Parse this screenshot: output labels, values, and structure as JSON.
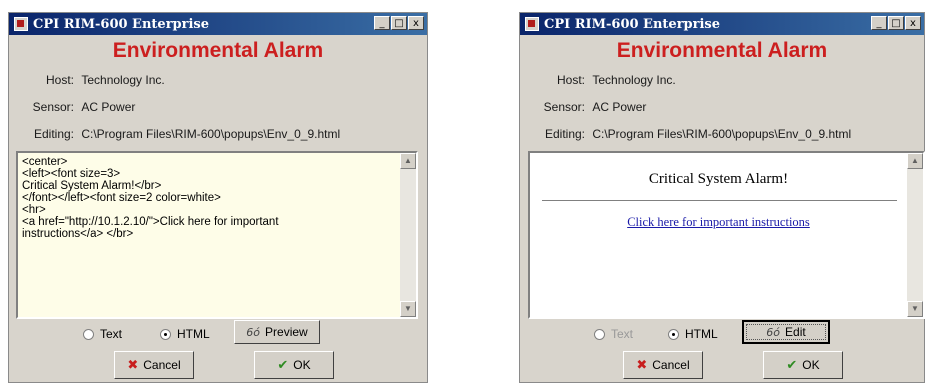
{
  "left": {
    "title": "CPI RIM-600 Enterprise",
    "heading": "Environmental Alarm",
    "host_label": "Host:",
    "host_value": "Technology Inc.",
    "sensor_label": "Sensor:",
    "sensor_value": "AC Power",
    "editing_label": "Editing:",
    "editing_value": "C:\\Program Files\\RIM-600\\popups\\Env_0_9.html",
    "editor_text": "<center>\n<left><font size=3>\nCritical System Alarm!</br>\n</font></left><font size=2 color=white>\n<hr>\n<a href=\"http://10.1.2.10/\">Click here for important\ninstructions</a> </br>",
    "radio_text": "Text",
    "radio_html": "HTML",
    "mode_selected": "HTML",
    "action_button": "Preview",
    "cancel_label": "Cancel",
    "ok_label": "OK"
  },
  "right": {
    "title": "CPI RIM-600 Enterprise",
    "heading": "Environmental Alarm",
    "host_label": "Host:",
    "host_value": "Technology Inc.",
    "sensor_label": "Sensor:",
    "sensor_value": "AC Power",
    "editing_label": "Editing:",
    "editing_value": "C:\\Program Files\\RIM-600\\popups\\Env_0_9.html",
    "preview_title": "Critical System Alarm!",
    "preview_link": "Click here for important instructions",
    "radio_text": "Text",
    "radio_html": "HTML",
    "mode_selected": "HTML",
    "action_button": "Edit",
    "cancel_label": "Cancel",
    "ok_label": "OK"
  },
  "window_controls": {
    "minimize": "_",
    "maximize": "□",
    "close": "x"
  },
  "colors": {
    "heading": "#cc1f1f",
    "editor_bg": "#fefde8",
    "titlebar": "#0a246a",
    "link": "#1a1aa8"
  },
  "icons": {
    "cancel": "x-icon",
    "ok": "check-icon",
    "preview": "glasses-icon",
    "app": "app-icon"
  }
}
